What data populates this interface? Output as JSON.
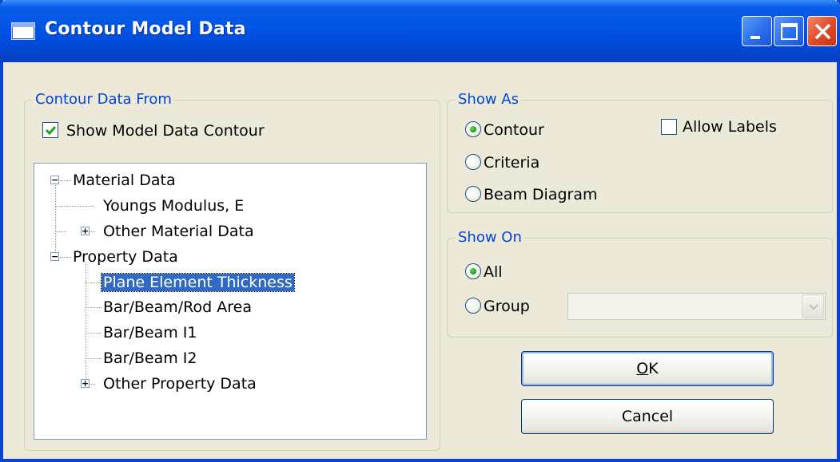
{
  "window": {
    "title": "Contour Model Data"
  },
  "contour_data_from": {
    "legend": "Contour Data From",
    "show_model_data_contour": {
      "label": "Show Model Data Contour",
      "checked": true
    },
    "tree": [
      {
        "label": "Material Data",
        "expander": "−",
        "level": 0
      },
      {
        "label": "Youngs Modulus, E",
        "level": 1
      },
      {
        "label": "Other Material Data",
        "expander": "+",
        "level": 1
      },
      {
        "label": "Property Data",
        "expander": "−",
        "level": 0
      },
      {
        "label": "Plane Element Thickness",
        "level": 1,
        "selected": true
      },
      {
        "label": "Bar/Beam/Rod Area",
        "level": 1
      },
      {
        "label": "Bar/Beam I1",
        "level": 1
      },
      {
        "label": "Bar/Beam I2",
        "level": 1
      },
      {
        "label": "Other Property Data",
        "expander": "+",
        "level": 1
      }
    ]
  },
  "show_as": {
    "legend": "Show As",
    "options": [
      {
        "label": "Contour",
        "selected": true
      },
      {
        "label": "Criteria",
        "selected": false
      },
      {
        "label": "Beam Diagram",
        "selected": false
      }
    ],
    "allow_labels": {
      "label": "Allow Labels",
      "checked": false
    }
  },
  "show_on": {
    "legend": "Show On",
    "options": [
      {
        "label": "All",
        "selected": true
      },
      {
        "label": "Group",
        "selected": false
      }
    ],
    "group_select_value": ""
  },
  "buttons": {
    "ok": {
      "mnemonic": "O",
      "rest": "K"
    },
    "cancel": "Cancel"
  },
  "colors": {
    "titlebar": "#0055E5",
    "legend_text": "#0046D5",
    "selection": "#316AC5",
    "radio_dot": "#21A121",
    "check_mark": "#21A121"
  }
}
